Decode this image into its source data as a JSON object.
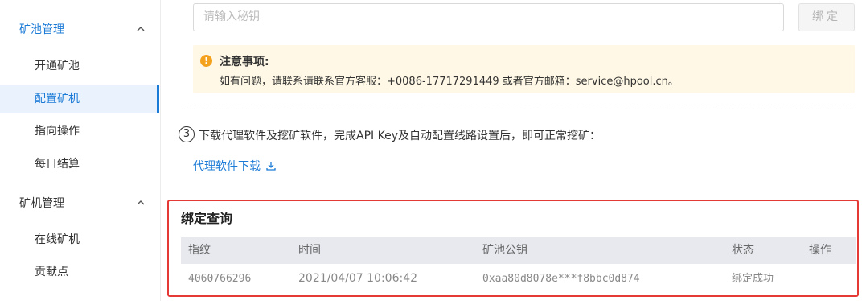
{
  "sidebar": {
    "groups": [
      {
        "title": "矿池管理",
        "items": [
          "开通矿池",
          "配置矿机",
          "指向操作",
          "每日结算"
        ]
      },
      {
        "title": "矿机管理",
        "items": [
          "在线矿机",
          "贡献点"
        ]
      }
    ],
    "selected": "配置矿机"
  },
  "bind_form": {
    "placeholder": "请输入秘钥",
    "button_label": "绑定"
  },
  "notice": {
    "icon": "!",
    "title": "注意事项:",
    "text": "如有问题，请联系请联系官方客服：+0086-17717291449 或者官方邮箱：service@hpool.cn。"
  },
  "step3": {
    "number": "3",
    "text": "下载代理软件及挖矿软件，完成API Key及自动配置线路设置后，即可正常挖矿：",
    "link_label": "代理软件下载"
  },
  "query": {
    "title": "绑定查询",
    "columns": [
      "指纹",
      "时间",
      "矿池公钥",
      "状态",
      "操作"
    ],
    "rows": [
      {
        "fingerprint": "4060766296",
        "time": "2021/04/07 10:06:42",
        "pubkey": "0xaa80d8078e***f8bbc0d874",
        "status": "绑定成功",
        "action": ""
      }
    ]
  },
  "colors": {
    "accent": "#1a7ad6",
    "highlight_border": "#e53935",
    "warning": "#f4a11e"
  }
}
